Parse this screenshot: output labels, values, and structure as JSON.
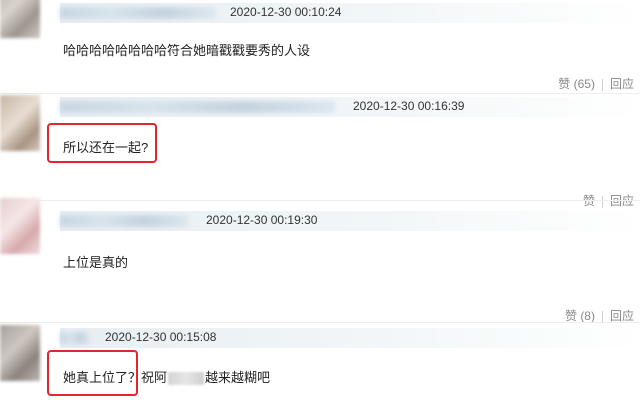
{
  "comments": [
    {
      "timestamp": "2020-12-30 00:10:24",
      "text": "哈哈哈哈哈哈哈哈符合她暗戳戳要秀的人设",
      "like_label": "赞",
      "like_count": "(65)",
      "reply_label": "回应"
    },
    {
      "timestamp": "2020-12-30 00:16:39",
      "text": "所以还在一起?",
      "like_label": "赞",
      "reply_label": "回应"
    },
    {
      "timestamp": "2020-12-30 00:19:30",
      "text": "上位是真的",
      "like_label": "赞",
      "like_count": "(8)",
      "reply_label": "回应"
    },
    {
      "timestamp": "2020-12-30 00:15:08",
      "text_part1": "她真上位了？",
      "text_part2": "祝阿",
      "text_part3": "越来越糊吧"
    }
  ],
  "colors": {
    "highlight": "#e3262b",
    "meta_strip": "#e7eef3",
    "action_text": "#888888"
  }
}
